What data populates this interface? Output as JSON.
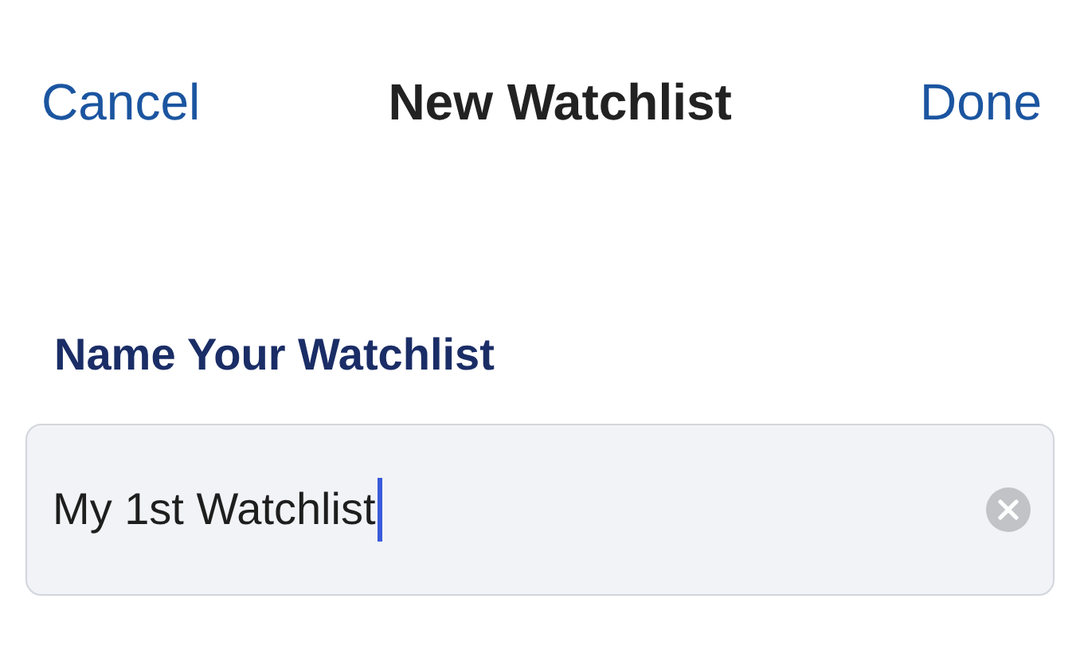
{
  "nav_bar": {
    "cancel": "Cancel",
    "title": "New Watchlist",
    "done": "Done"
  },
  "form": {
    "label": "Name Your Watchlist",
    "field": {
      "value": "My 1st Watchlist",
      "focused": true
    }
  }
}
